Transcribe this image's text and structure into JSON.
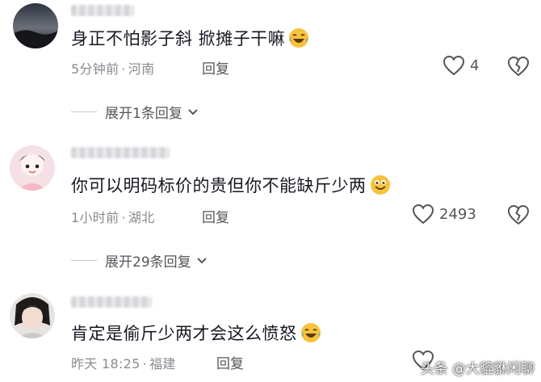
{
  "comments": [
    {
      "text": "身正不怕影子斜  掀摊子干嘛",
      "emoji": "laughing-tears-emoji",
      "time": "5分钟前",
      "location": "河南",
      "reply_label": "回复",
      "likes": "4",
      "expand_label": "展开1条回复"
    },
    {
      "text": "你可以明码标价的贵但你不能缺斤少两",
      "emoji": "grin-emoji",
      "time": "1小时前",
      "location": "湖北",
      "reply_label": "回复",
      "likes": "2493",
      "expand_label": "展开29条回复"
    },
    {
      "text": "肯定是偷斤少两才会这么愤怒",
      "emoji": "laughing-tears-emoji",
      "time": "昨天 18:25",
      "location": "福建",
      "reply_label": "回复",
      "likes": "",
      "expand_label": ""
    }
  ],
  "watermark": "头条 @大貔貅闲聊",
  "colors": {
    "text": "#161823",
    "meta": "#8a8b91",
    "action": "#55565b"
  }
}
